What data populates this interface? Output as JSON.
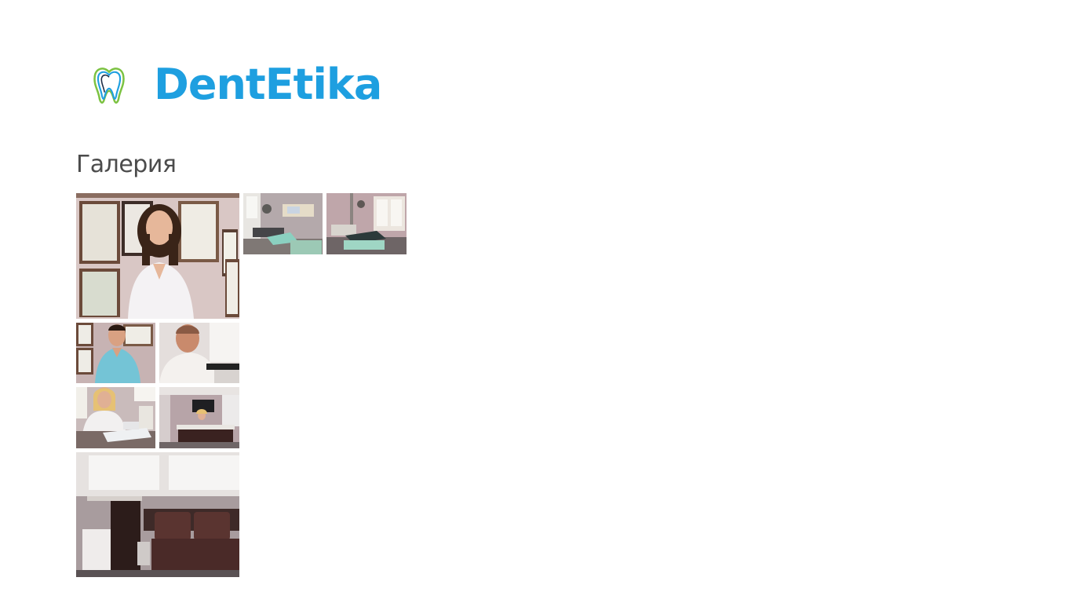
{
  "brand": {
    "name": "DentEtika",
    "icon": "tooth-logo-icon",
    "color": "#1e9fe0"
  },
  "gallery": {
    "title": "Галерия",
    "images": [
      {
        "name": "doctor-portrait-woman-certificates",
        "icon": "photo"
      },
      {
        "name": "dental-chair-room-1",
        "icon": "photo"
      },
      {
        "name": "dental-chair-room-2",
        "icon": "photo"
      },
      {
        "name": "dentist-man-blue-scrubs",
        "icon": "photo"
      },
      {
        "name": "dentist-man-at-desk",
        "icon": "photo"
      },
      {
        "name": "receptionist-woman-at-desk",
        "icon": "photo"
      },
      {
        "name": "office-desk-wide",
        "icon": "photo"
      },
      {
        "name": "waiting-room-sofa",
        "icon": "photo"
      }
    ]
  }
}
